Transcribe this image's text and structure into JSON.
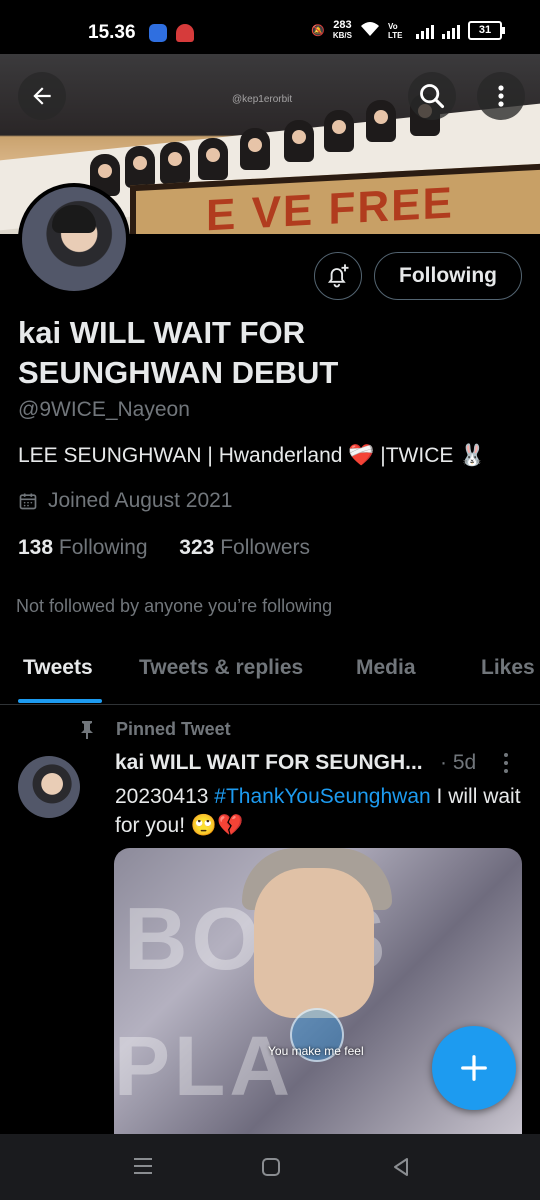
{
  "status_bar": {
    "time": "15.36",
    "network_speed": "283",
    "network_unit": "KB/S",
    "network_type": "Vo LTE",
    "battery": "31"
  },
  "banner": {
    "watermark": "@kep1erorbit",
    "sign_text": "E VE FREE"
  },
  "profile": {
    "display_name": "kai WILL WAIT FOR SEUNGHWAN DEBUT",
    "handle": "@9WICE_Nayeon",
    "bio": "LEE SEUNGHWAN | Hwanderland ❤️‍🩹 |TWICE 🐰",
    "joined": "Joined August 2021",
    "following_count": "138",
    "following_label": "Following",
    "followers_count": "323",
    "followers_label": "Followers",
    "not_followed_note": "Not followed by anyone you’re following",
    "follow_button_label": "Following"
  },
  "tabs": [
    {
      "label": "Tweets"
    },
    {
      "label": "Tweets & replies"
    },
    {
      "label": "Media"
    },
    {
      "label": "Likes"
    }
  ],
  "pinned_tweet": {
    "pinned_label": "Pinned Tweet",
    "author_name": "kai WILL WAIT FOR SEUNGH...",
    "time": "· 5d",
    "text_prefix": "20230413 ",
    "hashtag": "#ThankYouSeunghwan",
    "text_suffix": " I will wait for you! 🙄💔",
    "media_caption": "You make me feel",
    "media_letters_top": "BOYS",
    "media_letters_bottom": "PLA"
  },
  "colors": {
    "accent": "#1d9bf0",
    "background": "#000000",
    "secondary_text": "#71767b"
  }
}
